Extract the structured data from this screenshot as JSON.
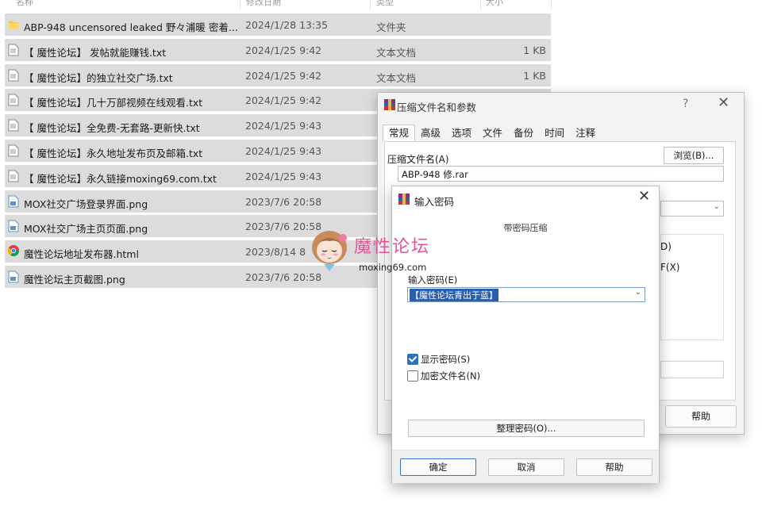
{
  "explorer": {
    "columns": [
      "名称",
      "修改日期",
      "类型",
      "大小"
    ],
    "files": [
      {
        "icon": "folder-icon",
        "name": "ABP-948 uncensored leaked 野々浦暖 密着...",
        "date": "2024/1/28 13:35",
        "type": "文件夹",
        "size": ""
      },
      {
        "icon": "text-file-icon",
        "name": "【 魔性论坛】 发帖就能赚钱.txt",
        "date": "2024/1/25 9:42",
        "type": "文本文档",
        "size": "1 KB"
      },
      {
        "icon": "text-file-icon",
        "name": "【 魔性论坛】的独立社交广场.txt",
        "date": "2024/1/25 9:42",
        "type": "文本文档",
        "size": "1 KB"
      },
      {
        "icon": "text-file-icon",
        "name": "【 魔性论坛】几十万部视频在线观看.txt",
        "date": "2024/1/25 9:42",
        "type": "",
        "size": ""
      },
      {
        "icon": "text-file-icon",
        "name": "【 魔性论坛】全免费-无套路-更新快.txt",
        "date": "2024/1/25 9:43",
        "type": "",
        "size": ""
      },
      {
        "icon": "text-file-icon",
        "name": "【 魔性论坛】永久地址发布页及邮箱.txt",
        "date": "2024/1/25 9:43",
        "type": "",
        "size": ""
      },
      {
        "icon": "text-file-icon",
        "name": "【 魔性论坛】永久链接moxing69.com.txt",
        "date": "2024/1/25 9:43",
        "type": "",
        "size": ""
      },
      {
        "icon": "image-file-icon",
        "name": "MOX社交广场登录界面.png",
        "date": "2023/7/6 20:58",
        "type": "",
        "size": ""
      },
      {
        "icon": "image-file-icon",
        "name": "MOX社交广场主页页面.png",
        "date": "2023/7/6 20:58",
        "type": "",
        "size": ""
      },
      {
        "icon": "chrome-icon",
        "name": "魔性论坛地址发布器.html",
        "date": "2023/8/14 8",
        "type": "",
        "size": ""
      },
      {
        "icon": "image-file-icon",
        "name": "魔性论坛主页截图.png",
        "date": "2023/7/6 20:58",
        "type": "",
        "size": ""
      }
    ]
  },
  "archive_dialog": {
    "title": "压缩文件名和参数",
    "help_glyph": "?",
    "close_glyph": "✕",
    "tabs": [
      "常规",
      "高级",
      "选项",
      "文件",
      "备份",
      "时间",
      "注释"
    ],
    "archive_name_label": "压缩文件名(A)",
    "browse_label": "浏览(B)...",
    "archive_name_value": "ABP-948 修.rar",
    "clipped_option_1": "D)",
    "clipped_option_2": "F(X)",
    "help_label": "帮助"
  },
  "password_dialog": {
    "title": "输入密码",
    "close_glyph": "✕",
    "caption": "带密码压缩",
    "password_label": "输入密码(E)",
    "password_value": "【魔性论坛青出于蓝】",
    "show_password_label": "显示密码(S)",
    "show_password_checked": true,
    "encrypt_names_label": "加密文件名(N)",
    "encrypt_names_checked": false,
    "manage_label": "整理密码(O)...",
    "ok_label": "确定",
    "cancel_label": "取消",
    "help_label": "帮助"
  },
  "watermark": {
    "text_cn": "魔性论坛",
    "text_en": "moxing69.com"
  },
  "colors": {
    "row_bg": "#dcdcdc",
    "selection": "#2b5fad",
    "watermark_pink": "#e2559a"
  }
}
